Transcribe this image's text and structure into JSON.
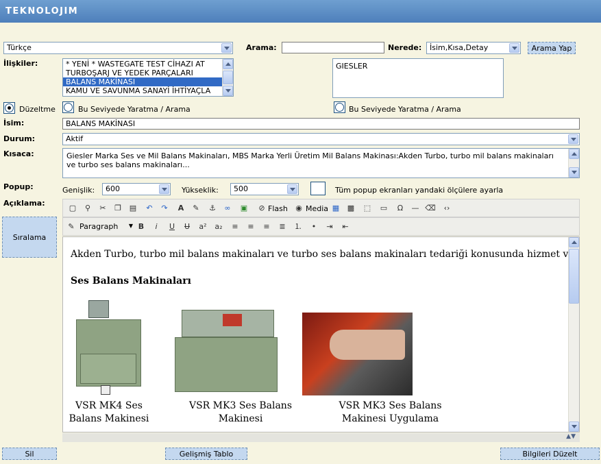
{
  "header": {
    "logo": "TEKNOLOJIM"
  },
  "search": {
    "language": "Türkçe",
    "arama_label": "Arama:",
    "arama_value": "",
    "nerede_label": "Nerede:",
    "nerede_value": "İsim,Kısa,Detay",
    "button": "Arama Yap"
  },
  "relations": {
    "label": "İlişkiler:",
    "items": [
      "* YENİ * WASTEGATE TEST CİHAZI AT",
      "TURBOŞARJ VE YEDEK PARÇALARI",
      "BALANS MAKİNASI",
      "KAMU VE SAVUNMA SANAYİ İHTİYAÇLA"
    ],
    "selected_index": 2,
    "right_box": "GIESLER"
  },
  "mode": {
    "duzeltme": "Düzeltme",
    "create_left": "Bu Seviyede Yaratma / Arama",
    "create_right": "Bu Seviyede Yaratma / Arama"
  },
  "form": {
    "isim_label": "İsim:",
    "isim_value": "BALANS MAKİNASI",
    "durum_label": "Durum:",
    "durum_value": "Aktif",
    "kisaca_label": "Kısaca:",
    "kisaca_value": "Giesler Marka Ses ve Mil Balans Makinaları, MBS Marka Yerli Üretim Mil Balans Makinası:Akden Turbo, turbo mil balans makinaları ve turbo ses balans makinaları...",
    "popup_label": "Popup:",
    "genislik_label": "Genişlik:",
    "genislik_value": "600",
    "yukseklik_label": "Yükseklik:",
    "yukseklik_value": "500",
    "popup_all": "Tüm popup ekranları yandaki ölçülere ayarla",
    "aciklama_label": "Açıklama:"
  },
  "toolbar": {
    "flash": "Flash",
    "media": "Media",
    "paragraph": "Paragraph"
  },
  "editor": {
    "intro": "Akden Turbo, turbo mil balans makinaları ve turbo ses balans makinaları tedariği konusunda hizmet vermektedir.",
    "heading": "Ses Balans Makinaları",
    "cap1": "VSR MK4 Ses Balans Makinesi",
    "cap2": "VSR MK3 Ses Balans Makinesi",
    "cap3": "VSR MK3 Ses Balans Makinesi Uygulama"
  },
  "buttons": {
    "siralama": "Sıralama",
    "sil": "Sil",
    "gelismis": "Gelişmiş Tablo",
    "duzelt": "Bilgileri Düzelt"
  }
}
